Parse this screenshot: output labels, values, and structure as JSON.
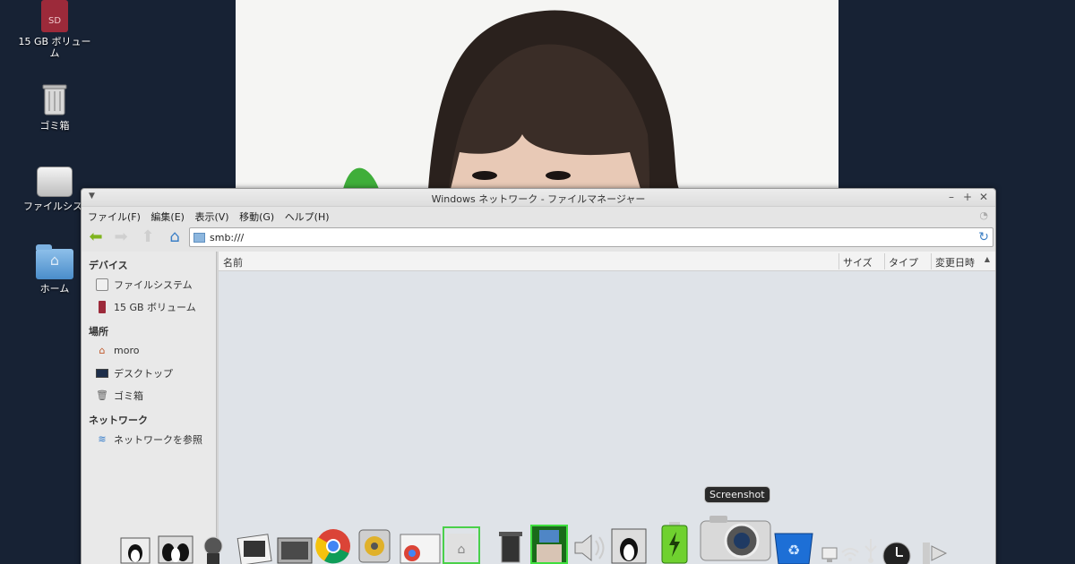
{
  "desktop": {
    "icons": [
      {
        "label": "15 GB ボリューム",
        "icon": "sd-card-icon"
      },
      {
        "label": "ゴミ箱",
        "icon": "trash-icon"
      },
      {
        "label": "ファイルシステム",
        "icon": "hard-drive-icon"
      },
      {
        "label": "ホーム",
        "icon": "home-folder-icon"
      }
    ]
  },
  "window": {
    "title": "Windows ネットワーク - ファイルマネージャー",
    "menu": [
      "ファイル(F)",
      "編集(E)",
      "表示(V)",
      "移動(G)",
      "ヘルプ(H)"
    ],
    "address": "smb:///",
    "sidebar": {
      "devices_heading": "デバイス",
      "devices": [
        "ファイルシステム",
        "15 GB ボリューム"
      ],
      "places_heading": "場所",
      "places": [
        "moro",
        "デスクトップ",
        "ゴミ箱"
      ],
      "network_heading": "ネットワーク",
      "network": [
        "ネットワークを参照"
      ]
    },
    "columns": [
      "名前",
      "サイズ",
      "タイプ",
      "変更日時"
    ]
  },
  "dock": {
    "tooltip": "Screenshot",
    "icons": [
      "tux-icon",
      "tux-group-icon",
      "mixer-icon",
      "photo-viewer-icon",
      "image-viewer-icon",
      "chrome-icon",
      "music-player-icon",
      "chrome-window-icon",
      "home-folder-icon",
      "trash-box-icon",
      "photo-frame-icon",
      "volume-icon",
      "tux-panel-icon",
      "battery-icon",
      "camera-icon",
      "recycle-bin-icon",
      "network-icon",
      "wifi-icon",
      "usb-icon",
      "clock-icon",
      "terminal-icon"
    ],
    "colors": {
      "battery": "#6fd12f",
      "chrome_red": "#db4437",
      "chrome_yellow": "#f4c20d",
      "chrome_green": "#0f9d58",
      "chrome_blue": "#4285f4"
    }
  }
}
